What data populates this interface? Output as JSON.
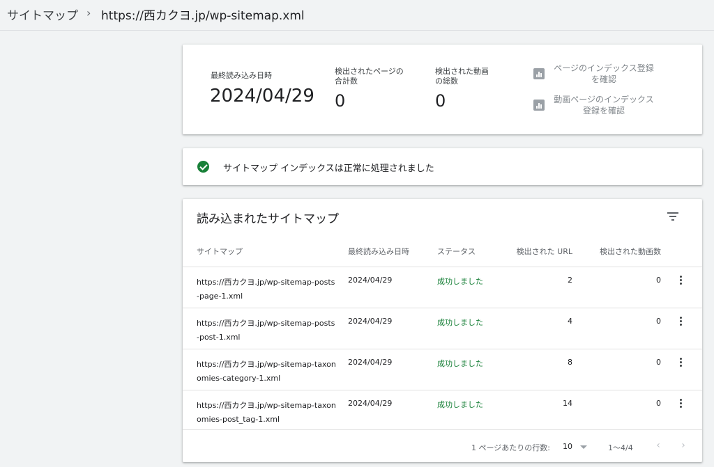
{
  "breadcrumb": {
    "root": "サイトマップ",
    "separator": "›",
    "current": "https://西カクヨ.jp/wp-sitemap.xml"
  },
  "summary": {
    "last_read_label": "最終読み込み日時",
    "last_read_value": "2024/04/29",
    "pages_label_1": "検出されたページの",
    "pages_label_2": "合計数",
    "pages_value": "0",
    "videos_label_1": "検出された動画",
    "videos_label_2": "の総数",
    "videos_value": "0",
    "link1_line1": "ページのインデックス登録",
    "link1_line2": "を確認",
    "link2_line1": "動画ページのインデックス",
    "link2_line2": "登録を確認",
    "icon": "bar-chart-icon"
  },
  "status": {
    "text": "サイトマップ インデックスは正常に処理されました",
    "icon": "check-circle-icon",
    "color": "#188038"
  },
  "table": {
    "title": "読み込まれたサイトマップ",
    "headers": {
      "sitemap": "サイトマップ",
      "last_read": "最終読み込み日時",
      "status": "ステータス",
      "urls": "検出された URL",
      "videos": "検出された動画数"
    },
    "rows": [
      {
        "url": "https://西カクヨ.jp/wp-sitemap-posts-page-1.xml",
        "date": "2024/04/29",
        "status": "成功しました",
        "urls": "2",
        "videos": "0"
      },
      {
        "url": "https://西カクヨ.jp/wp-sitemap-posts-post-1.xml",
        "date": "2024/04/29",
        "status": "成功しました",
        "urls": "4",
        "videos": "0"
      },
      {
        "url": "https://西カクヨ.jp/wp-sitemap-taxonomies-category-1.xml",
        "date": "2024/04/29",
        "status": "成功しました",
        "urls": "8",
        "videos": "0"
      },
      {
        "url": "https://西カクヨ.jp/wp-sitemap-taxonomies-post_tag-1.xml",
        "date": "2024/04/29",
        "status": "成功しました",
        "urls": "14",
        "videos": "0"
      }
    ],
    "footer": {
      "rows_per_page_label": "1 ページあたりの行数:",
      "rows_per_page_value": "10",
      "range": "1〜4/4",
      "prev": "‹",
      "next": "›"
    }
  }
}
